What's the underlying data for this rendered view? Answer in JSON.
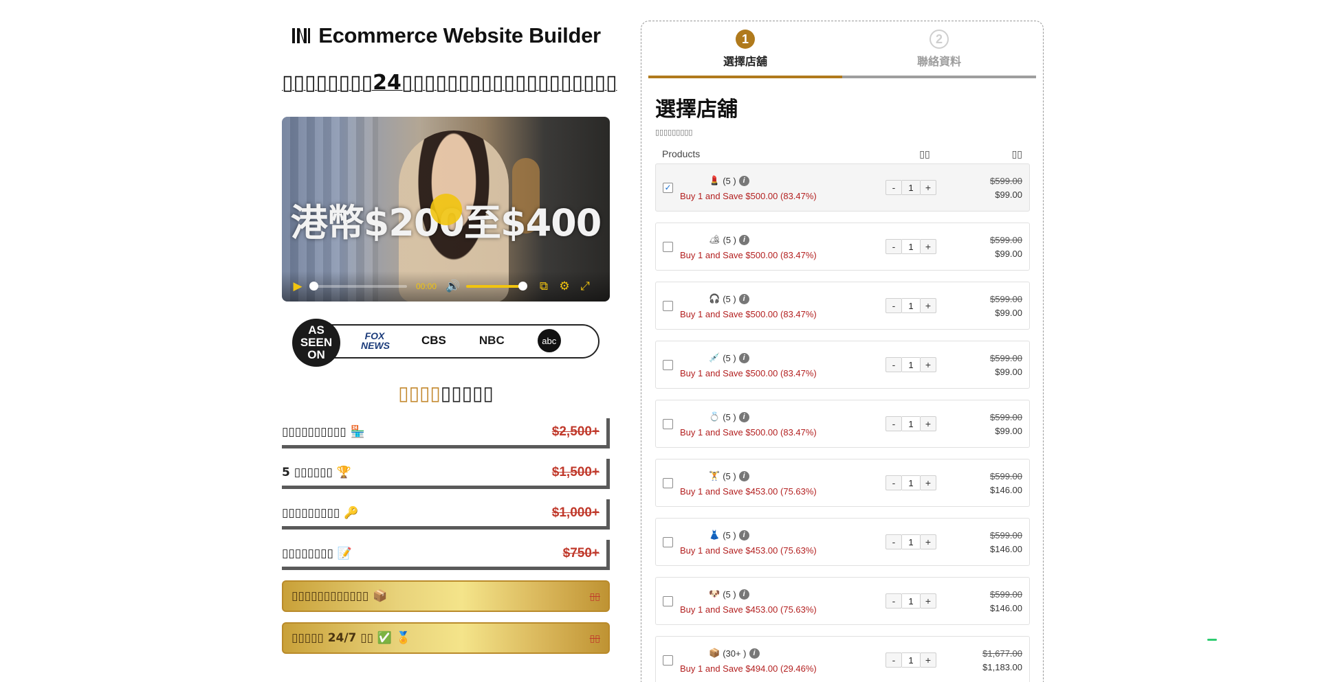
{
  "brand": {
    "name": "Ecommerce Website Builder"
  },
  "hero": {
    "headline": "▯▯▯▯▯▯▯▯24▯▯▯▯▯▯▯▯▯▯▯▯▯▯▯▯▯▯▯"
  },
  "video": {
    "overlay_text": "港幣$200至$400",
    "time": "00:00"
  },
  "as_seen_on": {
    "badge_lines": [
      "AS",
      "SEEN",
      "ON"
    ],
    "networks": [
      "FOX NEWS",
      "CBS",
      "NBC",
      "abc"
    ]
  },
  "value_section": {
    "accent": "▯▯▯▯",
    "rest": "▯▯▯▯▯",
    "rows": [
      {
        "name": "▯▯▯▯▯▯▯▯▯▯ 🏪",
        "price": "$2,500+"
      },
      {
        "name": "5 ▯▯▯▯▯▯ 🏆",
        "price": "$1,500+"
      },
      {
        "name": "▯▯▯▯▯▯▯▯▯ 🔑",
        "price": "$1,000+"
      },
      {
        "name": "▯▯▯▯▯▯▯▯ 📝",
        "price": "$750+"
      }
    ],
    "gold_rows": [
      {
        "name": "▯▯▯▯▯▯▯▯▯▯▯▯ 📦",
        "tag": "▯▯"
      },
      {
        "name": "▯▯▯▯▯ 24/7 ▯▯ ✅ 🏅",
        "tag": "▯▯"
      }
    ]
  },
  "checkout": {
    "steps": [
      {
        "num": "1",
        "label": "選擇店舖"
      },
      {
        "num": "2",
        "label": "聯絡資料"
      }
    ],
    "title": "選擇店舖",
    "subtitle": "▯▯▯▯▯▯▯▯▯",
    "headers": {
      "products": "Products",
      "qty": "▯▯",
      "price": "▯▯"
    },
    "products": [
      {
        "icon": "💄",
        "name": "(5 )",
        "save": "Buy 1 and Save $500.00",
        "pct": "(83.47%)",
        "qty": "1",
        "old": "$599.00",
        "new": "$99.00",
        "checked": "✓"
      },
      {
        "icon": "🏕",
        "name": "(5 )",
        "save": "Buy 1 and Save $500.00",
        "pct": "(83.47%)",
        "qty": "1",
        "old": "$599.00",
        "new": "$99.00",
        "checked": ""
      },
      {
        "icon": "🎧",
        "name": "(5 )",
        "save": "Buy 1 and Save $500.00",
        "pct": "(83.47%)",
        "qty": "1",
        "old": "$599.00",
        "new": "$99.00",
        "checked": ""
      },
      {
        "icon": "💉",
        "name": "(5 )",
        "save": "Buy 1 and Save $500.00",
        "pct": "(83.47%)",
        "qty": "1",
        "old": "$599.00",
        "new": "$99.00",
        "checked": ""
      },
      {
        "icon": "💍",
        "name": "(5 )",
        "save": "Buy 1 and Save $500.00",
        "pct": "(83.47%)",
        "qty": "1",
        "old": "$599.00",
        "new": "$99.00",
        "checked": ""
      },
      {
        "icon": "🏋",
        "name": "(5 )",
        "save": "Buy 1 and Save $453.00",
        "pct": "(75.63%)",
        "qty": "1",
        "old": "$599.00",
        "new": "$146.00",
        "checked": ""
      },
      {
        "icon": "👗",
        "name": "(5 )",
        "save": "Buy 1 and Save $453.00",
        "pct": "(75.63%)",
        "qty": "1",
        "old": "$599.00",
        "new": "$146.00",
        "checked": ""
      },
      {
        "icon": "🐶",
        "name": "(5 )",
        "save": "Buy 1 and Save $453.00",
        "pct": "(75.63%)",
        "qty": "1",
        "old": "$599.00",
        "new": "$146.00",
        "checked": ""
      },
      {
        "icon": "📦",
        "name": "(30+ )",
        "save": "Buy 1 and Save $494.00",
        "pct": "(29.46%)",
        "qty": "1",
        "old": "$1,677.00",
        "new": "$1,183.00",
        "checked": ""
      }
    ]
  },
  "colors": {
    "accent_gold": "#b07a1c",
    "save_red": "#b32020",
    "strike_red": "#c0392b"
  }
}
